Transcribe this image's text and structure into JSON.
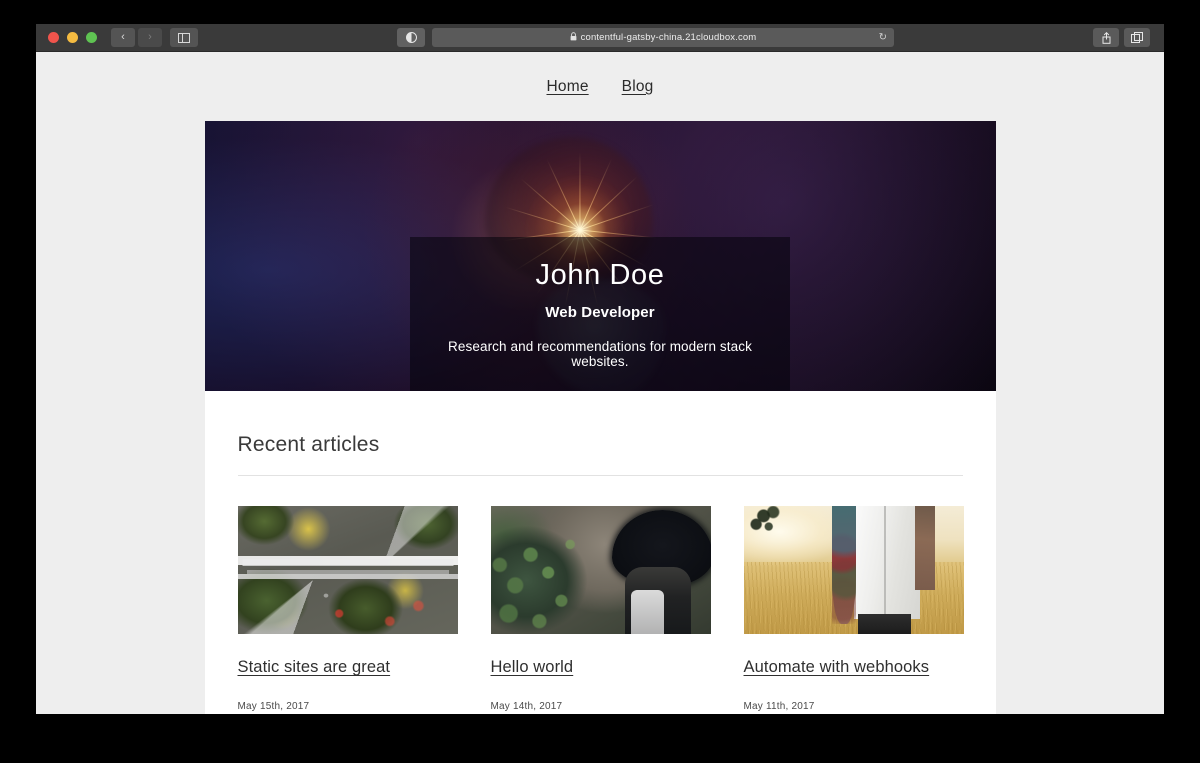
{
  "browser": {
    "traffic_lights": [
      {
        "name": "close",
        "color": "#f0544c"
      },
      {
        "name": "minimize",
        "color": "#f5bb41"
      },
      {
        "name": "maximize",
        "color": "#5fc352"
      }
    ],
    "back_label": "‹",
    "forward_label": "›",
    "sidebar_label": "☰",
    "lock_glyph": "🔒",
    "url": "contentful-gatsby-china.21cloudbox.com",
    "reload_glyph": "↻",
    "share_glyph": "↑",
    "tabs_glyph": "⧉"
  },
  "site": {
    "nav": [
      {
        "label": "Home"
      },
      {
        "label": "Blog"
      }
    ],
    "hero": {
      "title": "John Doe",
      "subtitle": "Web Developer",
      "description": "Research and recommendations for modern stack websites."
    },
    "articles_section": {
      "heading": "Recent articles",
      "cards": [
        {
          "title": "Static sites are great",
          "date": "May 15th, 2017",
          "image_name": "aerial-highway-interchange-photo"
        },
        {
          "title": "Hello world",
          "date": "May 14th, 2017",
          "image_name": "woman-with-black-hat-in-forest-photo"
        },
        {
          "title": "Automate with webhooks",
          "date": "May 11th, 2017",
          "image_name": "person-in-golden-wheat-field-photo"
        }
      ]
    }
  },
  "colors": {
    "page_background": "#eeeeee",
    "content_background": "#ffffff",
    "toolbar": "#3a3a3a",
    "text": "#2f2f2f",
    "rule": "#e2e2e2",
    "hero_overlay": "rgba(5,3,12,0.58)"
  }
}
